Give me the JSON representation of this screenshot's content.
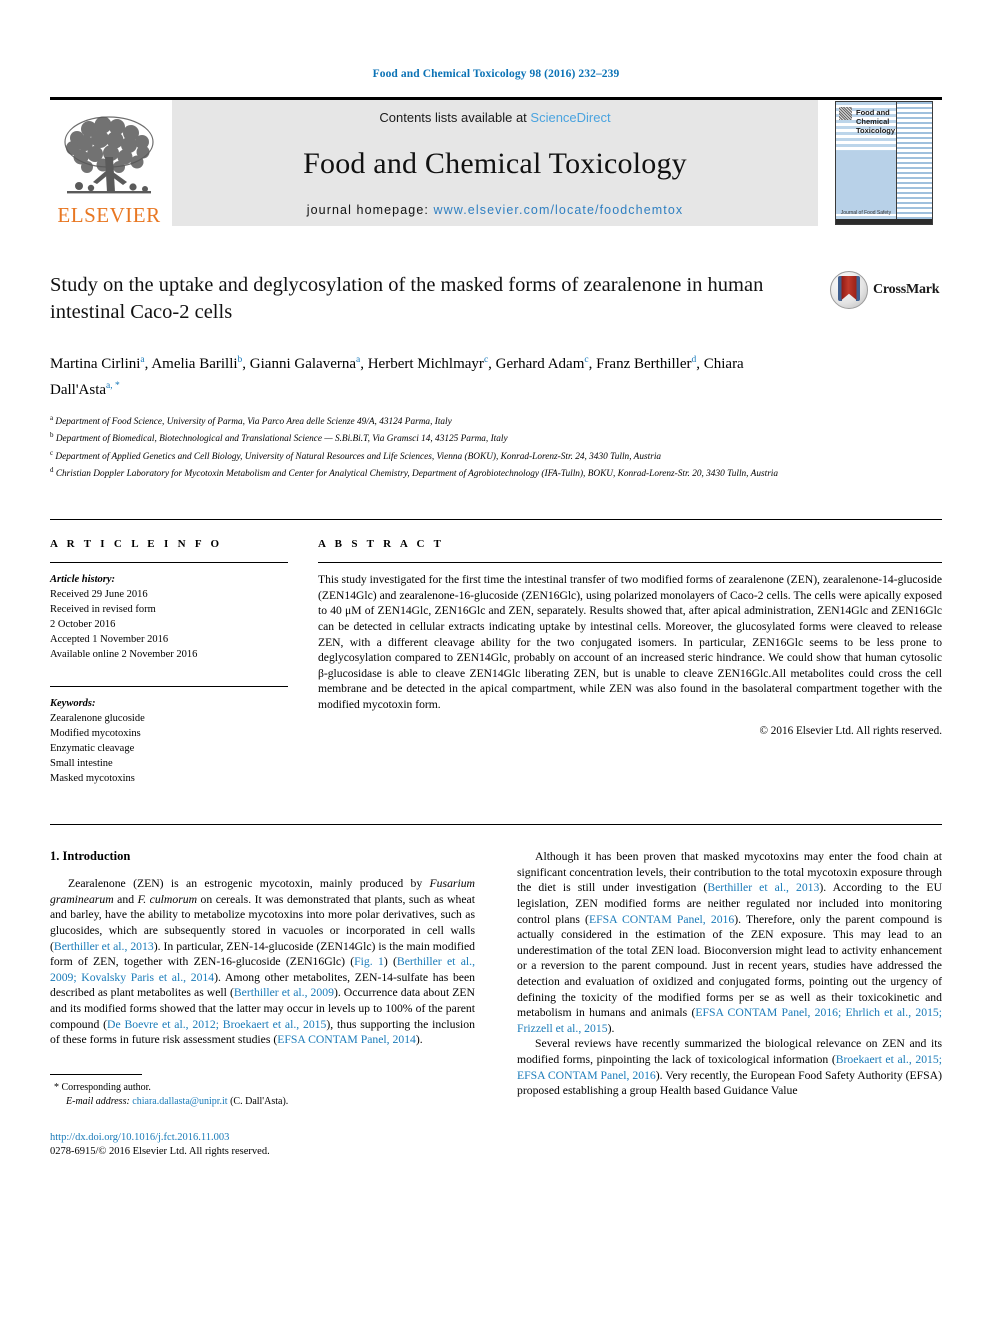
{
  "running_head": "Food and Chemical Toxicology 98 (2016) 232–239",
  "banner": {
    "contents_prefix": "Contents lists available at ",
    "sciencedirect": "ScienceDirect",
    "journal_title": "Food and Chemical Toxicology",
    "homepage_prefix": "journal homepage: ",
    "homepage_url": "www.elsevier.com/locate/foodchemtox",
    "publisher_wordmark": "ELSEVIER",
    "cover_title": "Food and Chemical Toxicology",
    "cover_footer": "Journal of Food Safety",
    "colors": {
      "link": "#4aa3df",
      "publisher_orange": "#e87722",
      "header_blue": "#0b72b5",
      "banner_bg": "#e6e6e6"
    }
  },
  "article": {
    "title": "Study on the uptake and deglycosylation of the masked forms of zearalenone in human intestinal Caco-2 cells",
    "crossmark_label": "CrossMark",
    "authors": [
      {
        "name": "Martina Cirlini",
        "marks": "a"
      },
      {
        "name": "Amelia Barilli",
        "marks": "b"
      },
      {
        "name": "Gianni Galaverna",
        "marks": "a"
      },
      {
        "name": "Herbert Michlmayr",
        "marks": "c"
      },
      {
        "name": "Gerhard Adam",
        "marks": "c"
      },
      {
        "name": "Franz Berthiller",
        "marks": "d"
      },
      {
        "name": "Chiara Dall'Asta",
        "marks": "a, *"
      }
    ],
    "affiliations": [
      {
        "mark": "a",
        "text": "Department of Food Science, University of Parma, Via Parco Area delle Scienze 49/A, 43124 Parma, Italy"
      },
      {
        "mark": "b",
        "text": "Department of Biomedical, Biotechnological and Translational Science — S.Bi.Bi.T, Via Gramsci 14, 43125 Parma, Italy"
      },
      {
        "mark": "c",
        "text": "Department of Applied Genetics and Cell Biology, University of Natural Resources and Life Sciences, Vienna (BOKU), Konrad-Lorenz-Str. 24, 3430 Tulln, Austria"
      },
      {
        "mark": "d",
        "text": "Christian Doppler Laboratory for Mycotoxin Metabolism and Center for Analytical Chemistry, Department of Agrobiotechnology (IFA-Tulln), BOKU, Konrad-Lorenz-Str. 20, 3430 Tulln, Austria"
      }
    ]
  },
  "article_info": {
    "heading": "A R T I C L E   I N F O",
    "history_label": "Article history:",
    "history": [
      "Received 29 June 2016",
      "Received in revised form",
      "2 October 2016",
      "Accepted 1 November 2016",
      "Available online 2 November 2016"
    ],
    "keywords_label": "Keywords:",
    "keywords": [
      "Zearalenone glucoside",
      "Modified mycotoxins",
      "Enzymatic cleavage",
      "Small intestine",
      "Masked mycotoxins"
    ]
  },
  "abstract": {
    "heading": "A B S T R A C T",
    "text": "This study investigated for the first time the intestinal transfer of two modified forms of zearalenone (ZEN), zearalenone-14-glucoside (ZEN14Glc) and zearalenone-16-glucoside (ZEN16Glc), using polarized monolayers of Caco-2 cells. The cells were apically exposed to 40 μM of ZEN14Glc, ZEN16Glc and ZEN, separately. Results showed that, after apical administration, ZEN14Glc and ZEN16Glc can be detected in cellular extracts indicating uptake by intestinal cells. Moreover, the glucosylated forms were cleaved to release ZEN, with a different cleavage ability for the two conjugated isomers. In particular, ZEN16Glc seems to be less prone to deglycosylation compared to ZEN14Glc, probably on account of an increased steric hindrance. We could show that human cytosolic β-glucosidase is able to cleave ZEN14Glc liberating ZEN, but is unable to cleave ZEN16Glc.All metabolites could cross the cell membrane and be detected in the apical compartment, while ZEN was also found in the basolateral compartment together with the modified mycotoxin form.",
    "copyright": "© 2016 Elsevier Ltd. All rights reserved."
  },
  "introduction": {
    "heading": "1.  Introduction",
    "left_paragraphs": [
      [
        {
          "t": "Zearalenone (ZEN) is an estrogenic mycotoxin, mainly produced by "
        },
        {
          "t": "Fusarium graminearum",
          "s": "i"
        },
        {
          "t": " and "
        },
        {
          "t": "F. culmorum",
          "s": "i"
        },
        {
          "t": " on cereals. It was demonstrated that plants, such as wheat and barley, have the ability to metabolize mycotoxins into more polar derivatives, such as glucosides, which are subsequently stored in vacuoles or incorporated in cell walls ("
        },
        {
          "t": "Berthiller et al., 2013",
          "s": "cite"
        },
        {
          "t": "). In particular, ZEN-14-glucoside (ZEN14Glc) is the main modified form of ZEN, together with ZEN-16-glucoside (ZEN16Glc) ("
        },
        {
          "t": "Fig. 1",
          "s": "cite"
        },
        {
          "t": ") ("
        },
        {
          "t": "Berthiller et al., 2009; Kovalsky Paris et al., 2014",
          "s": "cite"
        },
        {
          "t": "). Among other metabolites, ZEN-14-sulfate has been described as plant metabolites as well ("
        },
        {
          "t": "Berthiller et al., 2009",
          "s": "cite"
        },
        {
          "t": "). Occurrence data about ZEN and its modified forms showed that the latter may occur in levels up to 100% of the parent compound ("
        },
        {
          "t": "De Boevre et al., 2012; Broekaert et al., 2015",
          "s": "cite"
        },
        {
          "t": "), thus supporting the inclusion of these forms in future risk assessment studies ("
        },
        {
          "t": "EFSA CONTAM Panel, 2014",
          "s": "cite"
        },
        {
          "t": ")."
        }
      ]
    ],
    "right_paragraphs": [
      [
        {
          "t": "Although it has been proven that masked mycotoxins may enter the food chain at significant concentration levels, their contribution to the total mycotoxin exposure through the diet is still under investigation ("
        },
        {
          "t": "Berthiller et al., 2013",
          "s": "cite"
        },
        {
          "t": "). According to the EU legislation, ZEN modified forms are neither regulated nor included into monitoring control plans ("
        },
        {
          "t": "EFSA CONTAM Panel, 2016",
          "s": "cite"
        },
        {
          "t": "). Therefore, only the parent compound is actually considered in the estimation of the ZEN exposure. This may lead to an underestimation of the total ZEN load. Bioconversion might lead to activity enhancement or a reversion to the parent compound. Just in recent years, studies have addressed the detection and evaluation of oxidized and conjugated forms, pointing out the urgency of defining the toxicity of the modified forms per se as well as their toxicokinetic and metabolism in humans and animals ("
        },
        {
          "t": "EFSA CONTAM Panel, 2016; Ehrlich et al., 2015; Frizzell et al., 2015",
          "s": "cite"
        },
        {
          "t": ")."
        }
      ],
      [
        {
          "t": "Several reviews have recently summarized the biological relevance on ZEN and its modified forms, pinpointing the lack of toxicological information ("
        },
        {
          "t": "Broekaert et al., 2015; EFSA CONTAM Panel, 2016",
          "s": "cite"
        },
        {
          "t": "). Very recently, the European Food Safety Authority (EFSA) proposed establishing a group Health based Guidance Value"
        }
      ]
    ]
  },
  "footnotes": {
    "corresponding_marker": "*",
    "corresponding_label": "Corresponding author.",
    "email_label": "E-mail address:",
    "email": "chiara.dallasta@unipr.it",
    "email_suffix": "(C. Dall'Asta).",
    "doi_url": "http://dx.doi.org/10.1016/j.fct.2016.11.003",
    "issn_line": "0278-6915/© 2016 Elsevier Ltd. All rights reserved."
  }
}
